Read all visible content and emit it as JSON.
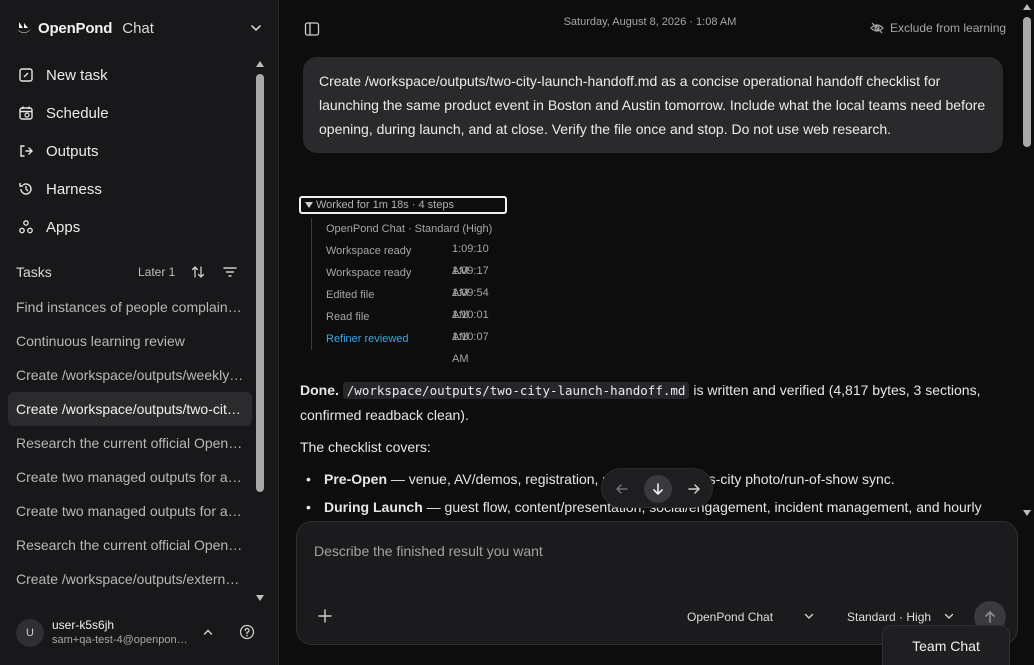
{
  "brand": {
    "name": "OpenPond",
    "product": "Chat"
  },
  "nav": [
    {
      "label": "New task",
      "icon": "pencil-icon"
    },
    {
      "label": "Schedule",
      "icon": "calendar-icon"
    },
    {
      "label": "Outputs",
      "icon": "export-icon"
    },
    {
      "label": "Harness",
      "icon": "history-icon"
    },
    {
      "label": "Apps",
      "icon": "apps-icon"
    }
  ],
  "tasks": {
    "title": "Tasks",
    "later": "Later 1",
    "items": [
      {
        "label": "Find instances of people complaining about AI models"
      },
      {
        "label": "Continuous learning review"
      },
      {
        "label": "Create /workspace/outputs/weekly-report.md"
      },
      {
        "label": "Create /workspace/outputs/two-city-launch-handoff.md",
        "active": true
      },
      {
        "label": "Research the current official OpenAI pricing"
      },
      {
        "label": "Create two managed outputs for a launch"
      },
      {
        "label": "Create two managed outputs for a report"
      },
      {
        "label": "Research the current official OpenPond docs"
      },
      {
        "label": "Create /workspace/outputs/external-brief.md"
      }
    ]
  },
  "user": {
    "initial": "U",
    "name": "user-k5s6jh",
    "email": "sam+qa-test-4@openpond.ai"
  },
  "header": {
    "timestamp": "Saturday, August 8, 2026 · 1:08 AM",
    "exclude": "Exclude from learning"
  },
  "user_message": "Create /workspace/outputs/two-city-launch-handoff.md as a concise operational handoff checklist for launching the same product event in Boston and Austin tomorrow. Include what the local teams need before opening, during launch, and at close. Verify the file once and stop. Do not use web research.",
  "work_log": {
    "summary": "Worked for 1m 18s · 4 steps",
    "meta": "OpenPond Chat · Standard (High)",
    "steps": [
      {
        "label": "Workspace ready",
        "time": "1:09:10 AM"
      },
      {
        "label": "Workspace ready",
        "time": "1:09:17 AM"
      },
      {
        "label": "Edited file",
        "time": "1:09:54 AM"
      },
      {
        "label": "Read file",
        "time": "1:10:01 AM"
      },
      {
        "label": "Refiner reviewed",
        "time": "1:10:07 AM",
        "link": true
      }
    ]
  },
  "answer": {
    "done": "Done.",
    "path": "/workspace/outputs/two-city-launch-handoff.md",
    "rest_line1": " is written and verified (4,817 bytes, 3 sections,",
    "rest_line2": "confirmed readback clean).",
    "covers": "The checklist covers:",
    "bullets": [
      {
        "bold": "Pre-Open",
        "text": " — venue, AV/demos, registration, staffing, and cross-city photo/run-of-show sync."
      },
      {
        "bold": "During Launch",
        "text": " — guest flow, content/presentation, social/engagement, incident management, and hourly"
      }
    ]
  },
  "composer": {
    "placeholder": "Describe the finished result you want",
    "model": "OpenPond Chat",
    "mode": "Standard · High"
  },
  "team_chat": "Team Chat"
}
